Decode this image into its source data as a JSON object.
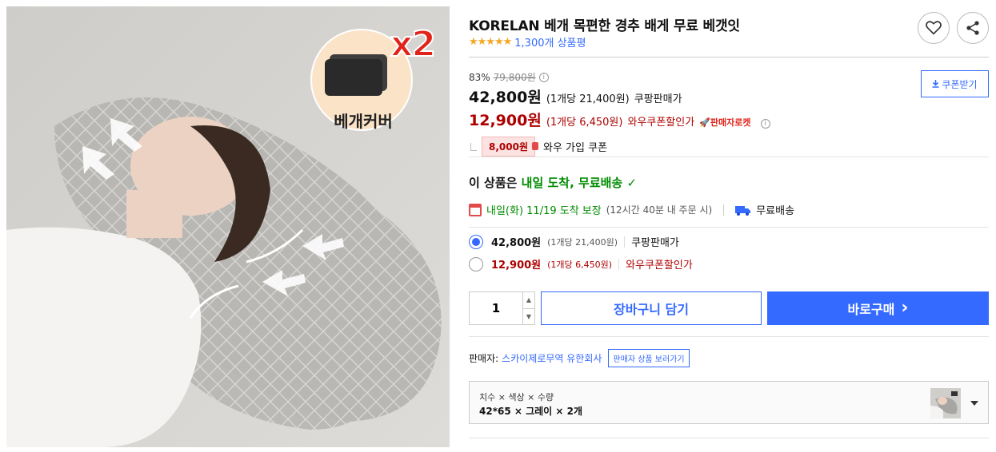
{
  "product_image": {
    "badge_count": "x2",
    "badge_label": "베개커버"
  },
  "product": {
    "title": "KORELAN 베개 목편한 경추 배게 무료 베갯잇",
    "rating": 4.5,
    "stars": "★★★★★",
    "review_count": "1,300개 상품평"
  },
  "actions": {
    "wishlist_icon": "heart-icon",
    "share_icon": "share-icon"
  },
  "price": {
    "discount_rate": "83%",
    "original_price": "79,800원",
    "info_mark": "i",
    "sale_price": "42,800원",
    "sale_unit": "(1개당 21,400원)",
    "sale_label": "쿠팡판매가",
    "coupon_price": "12,900원",
    "coupon_unit": "(1개당 6,450원)",
    "coupon_label": "와우쿠폰할인가",
    "rocket_label": "🚀판매자로켓",
    "wow_coupon_amount": "8,000원",
    "wow_coupon_text": "와우 가입 쿠폰",
    "coupon_button": "쿠폰받기"
  },
  "delivery": {
    "headline_prefix": "이 상품은",
    "headline_green": "내일 도착, 무료배송",
    "check": "✓",
    "date": "내일(화) 11/19 도착 보장",
    "note": "(12시간 40분 내 주문 시)",
    "free_shipping": "무료배송"
  },
  "options": [
    {
      "price": "42,800원",
      "unit": "(1개당 21,400원)",
      "label": "쿠팡판매가",
      "selected": true
    },
    {
      "price": "12,900원",
      "unit": "(1개당 6,450원)",
      "label": "와우쿠폰할인가",
      "selected": false
    }
  ],
  "purchase": {
    "quantity": "1",
    "stepper_up": "▲",
    "stepper_down": "▼",
    "cart_button": "장바구니 담기",
    "buy_button": "바로구매",
    "buy_chevron": "›"
  },
  "seller": {
    "prefix": "판매자:",
    "name": "스카이제로무역 유한회사",
    "button": "판매자 상품 보러가기"
  },
  "option_select": {
    "label": "치수 × 색상 × 수량",
    "value": "42*65 × 그레이 × 2개"
  },
  "colors": {
    "accent": "#346aff",
    "sale_red": "#ae0000",
    "delivery_green": "#008c00",
    "star": "#f5a623"
  }
}
